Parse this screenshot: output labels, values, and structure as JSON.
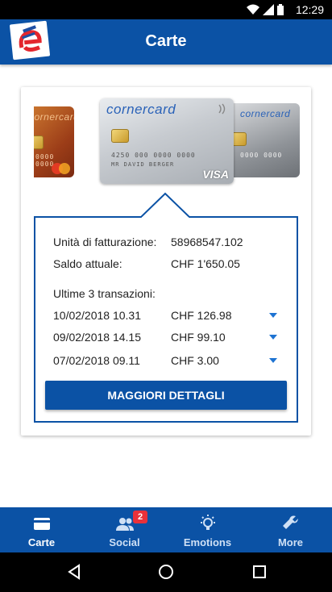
{
  "status": {
    "time": "12:29"
  },
  "appbar": {
    "title": "Carte"
  },
  "cards": {
    "left": {
      "brand": "cornercard",
      "number": "0000 0000"
    },
    "center": {
      "brand": "cornercard",
      "number": "4250 000 0000 0000",
      "holder": "MR DAVID BERGER",
      "network": "VISA"
    },
    "right": {
      "brand": "cornercard",
      "number": "0000 0000"
    }
  },
  "info": {
    "billing_unit_label": "Unità di fatturazione:",
    "billing_unit_value": "58968547.102",
    "balance_label": "Saldo attuale:",
    "balance_value": "CHF 1'650.05",
    "transactions_label": "Ultime 3 transazioni:",
    "transactions": [
      {
        "date": "10/02/2018 10.31",
        "amount": "CHF 126.98"
      },
      {
        "date": "09/02/2018 14.15",
        "amount": "CHF 99.10"
      },
      {
        "date": "07/02/2018 09.11",
        "amount": "CHF 3.00"
      }
    ],
    "details_button": "MAGGIORI DETTAGLI"
  },
  "bottom_nav": {
    "items": [
      {
        "label": "Carte",
        "icon": "card-icon",
        "active": true
      },
      {
        "label": "Social",
        "icon": "people-icon",
        "badge": "2"
      },
      {
        "label": "Emotions",
        "icon": "lightbulb-icon"
      },
      {
        "label": "More",
        "icon": "wrench-icon"
      }
    ]
  },
  "colors": {
    "primary": "#0b52a5",
    "accent": "#1e73d2",
    "badge": "#e8313a"
  }
}
